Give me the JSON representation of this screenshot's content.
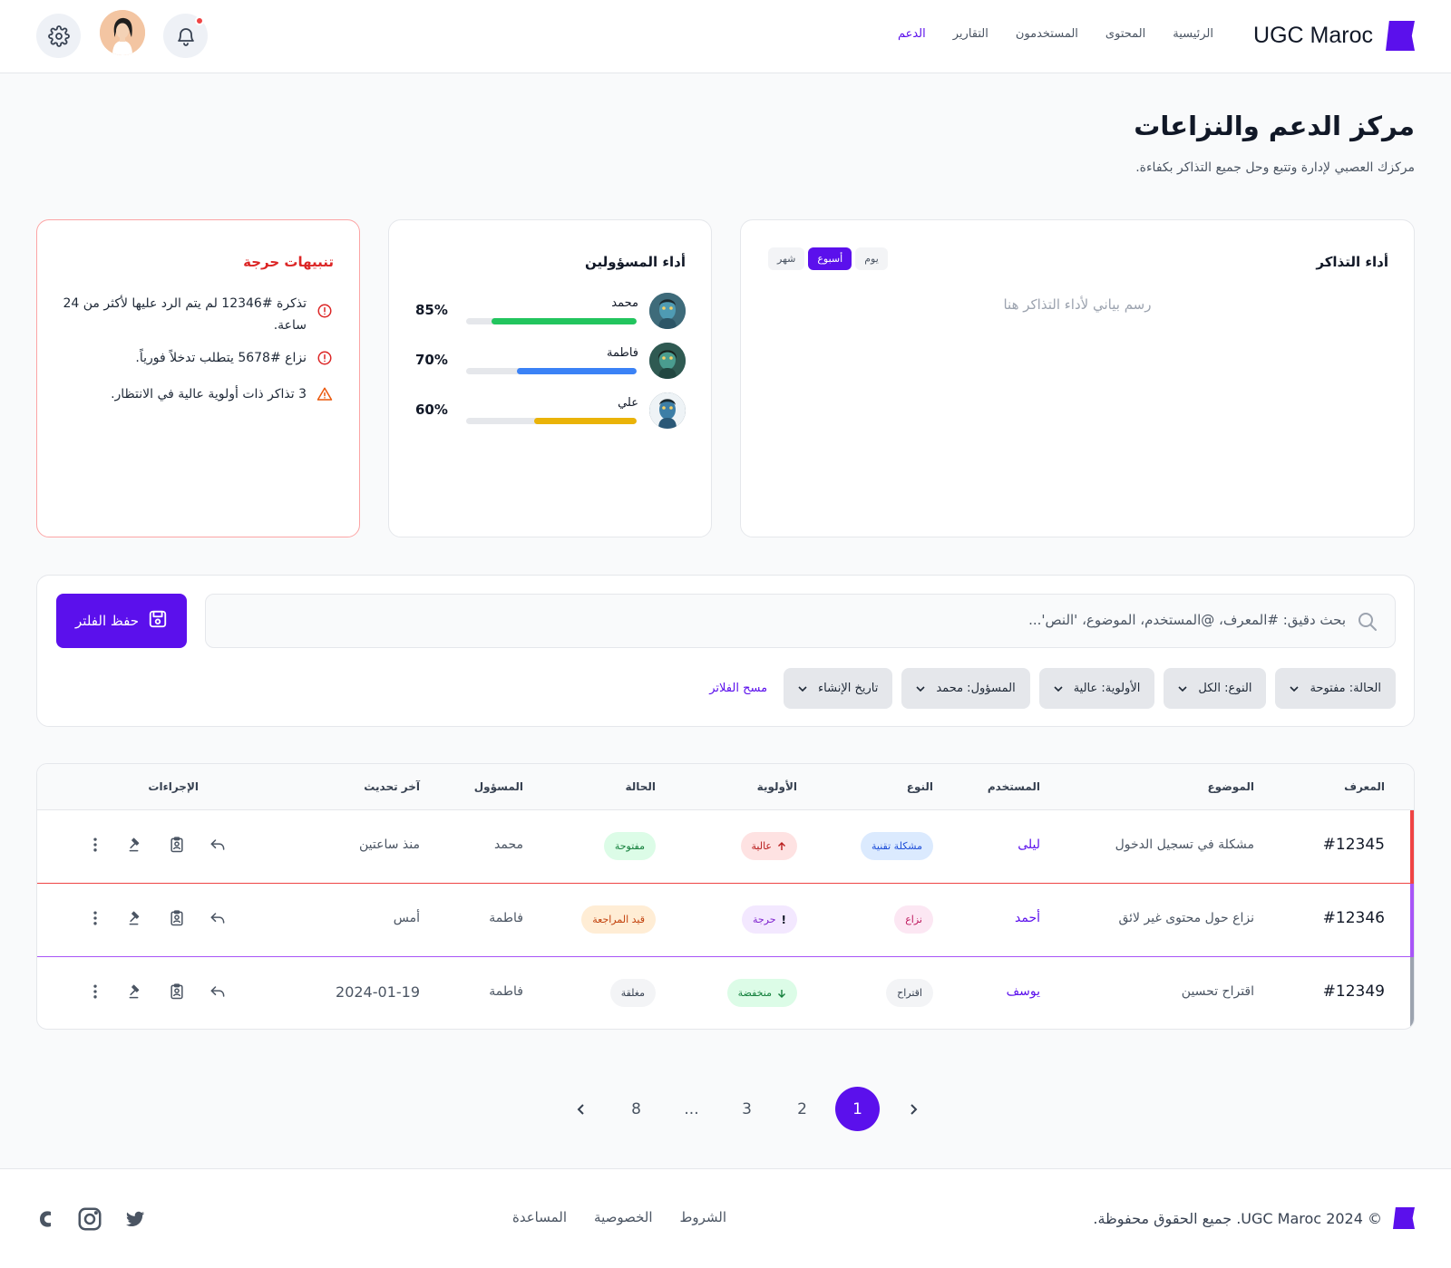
{
  "header": {
    "brand": "UGC Maroc",
    "nav": [
      {
        "label": "الرئيسية",
        "active": false
      },
      {
        "label": "المحتوى",
        "active": false
      },
      {
        "label": "المستخدمون",
        "active": false
      },
      {
        "label": "التقارير",
        "active": false
      },
      {
        "label": "الدعم",
        "active": true
      }
    ],
    "icons": [
      "bell-icon",
      "avatar",
      "gear-icon"
    ]
  },
  "page": {
    "title": "مركز الدعم والنزاعات",
    "subtitle": "مركزك العصبي لإدارة وتتبع وحل جميع التذاكر بكفاءة."
  },
  "ticket_perf": {
    "title": "أداء التذاكر",
    "ranges": [
      {
        "label": "يوم",
        "active": false
      },
      {
        "label": "أسبوع",
        "active": true
      },
      {
        "label": "شهر",
        "active": false
      }
    ],
    "placeholder": "رسم بياني لأداء التذاكر هنا"
  },
  "agents": {
    "title": "أداء المسؤولين",
    "items": [
      {
        "name": "محمد",
        "percent_label": "85%",
        "value": 0.85,
        "color": "#22c55e"
      },
      {
        "name": "فاطمة",
        "percent_label": "70%",
        "value": 0.7,
        "color": "#3b82f6"
      },
      {
        "name": "علي",
        "percent_label": "60%",
        "value": 0.6,
        "color": "#eab308"
      }
    ]
  },
  "alerts": {
    "title": "تنبيهات حرجة",
    "items": [
      {
        "icon": "error-circle-icon",
        "text": "تذكرة #12346 لم يتم الرد عليها لأكثر من 24 ساعة."
      },
      {
        "icon": "error-circle-icon",
        "text": "نزاع #5678 يتطلب تدخلاً فورياً."
      },
      {
        "icon": "warning-triangle-icon",
        "text": "3 تذاكر ذات أولوية عالية في الانتظار."
      }
    ]
  },
  "filters": {
    "search_placeholder": "بحث دقيق: #المعرف، @المستخدم، الموضوع، 'النص'...",
    "save_label": "حفظ الفلتر",
    "chips": [
      "الحالة: مفتوحة",
      "النوع: الكل",
      "الأولوية: عالية",
      "المسؤول: محمد",
      "تاريخ الإنشاء"
    ],
    "clear_label": "مسح الفلاتر"
  },
  "table": {
    "headers": {
      "id": "المعرف",
      "subject": "الموضوع",
      "user": "المستخدم",
      "type": "النوع",
      "priority": "الأولوية",
      "status": "الحالة",
      "assignee": "المسؤول",
      "updated": "آخر تحديث",
      "actions": "الإجراءات"
    },
    "rows": [
      {
        "id": "#12345",
        "subject": "مشكلة في تسجيل الدخول",
        "user": "ليلى",
        "type": "مشكلة تقنية",
        "priority": "عالية",
        "priority_icon": "arrow-up-icon",
        "status": "مفتوحة",
        "assignee": "محمد",
        "updated": "منذ ساعتين",
        "accent": "#ef4444"
      },
      {
        "id": "#12346",
        "subject": "نزاع حول محتوى غير لائق",
        "user": "أحمد",
        "type": "نزاع",
        "priority": "حرجة",
        "priority_icon": "exclamation-icon",
        "status": "قيد المراجعة",
        "assignee": "فاطمة",
        "updated": "أمس",
        "accent": "#a855f7"
      },
      {
        "id": "#12349",
        "subject": "اقتراح تحسين",
        "user": "يوسف",
        "type": "اقتراح",
        "priority": "منخفضة",
        "priority_icon": "arrow-down-icon",
        "status": "مغلقة",
        "assignee": "فاطمة",
        "updated": "2024-01-19",
        "accent": "#9ca3af"
      }
    ]
  },
  "pagination": {
    "pages": [
      "1",
      "2",
      "3",
      "...",
      "8"
    ],
    "active": "1"
  },
  "footer": {
    "copyright": "© 2024 UGC Maroc. جميع الحقوق محفوظة.",
    "links": [
      "الشروط",
      "الخصوصية",
      "المساعدة"
    ],
    "social": [
      "twitter-icon",
      "instagram-icon",
      "facebook-icon"
    ]
  }
}
